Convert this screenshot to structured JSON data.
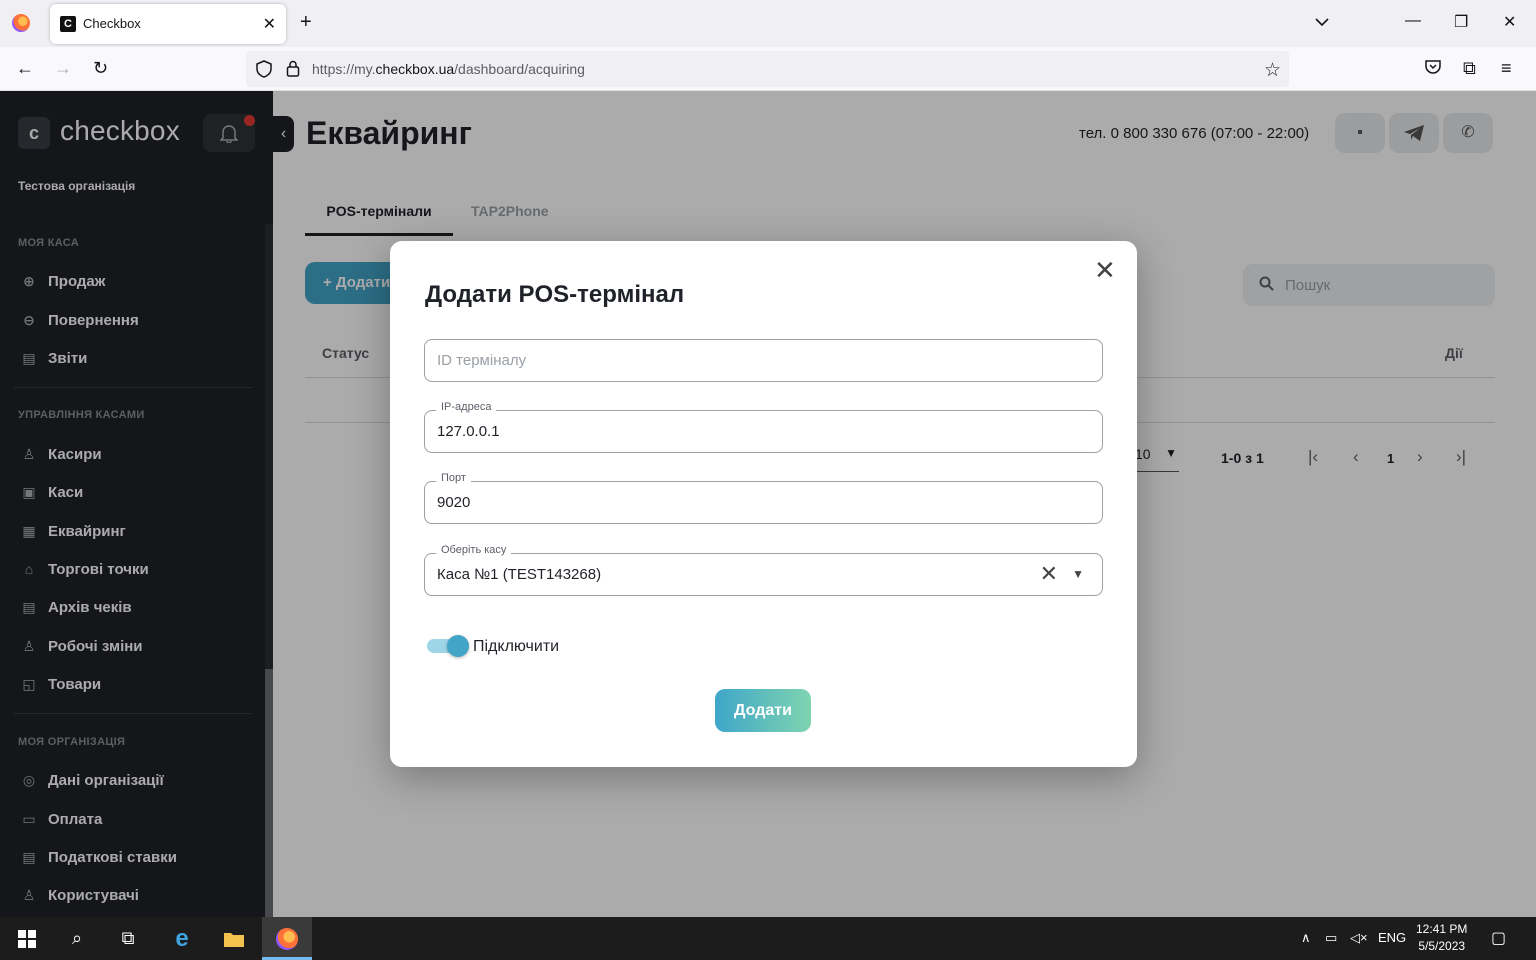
{
  "browser": {
    "tab_title": "Checkbox",
    "tab_favicon": "C",
    "url_prefix": "https://my.",
    "url_host": "checkbox.ua",
    "url_path": "/dashboard/acquiring"
  },
  "sidebar": {
    "brand": "checkbox",
    "brand_mark": "c",
    "org": "Тестова організація",
    "sections": [
      "МОЯ КАСА",
      "УПРАВЛІННЯ КАСАМИ",
      "МОЯ ОРГАНІЗАЦІЯ"
    ],
    "items": [
      {
        "label": "Продаж",
        "icon": "sale-icon"
      },
      {
        "label": "Повернення",
        "icon": "return-icon"
      },
      {
        "label": "Звіти",
        "icon": "report-icon"
      },
      {
        "label": "Касири",
        "icon": "cashier-icon"
      },
      {
        "label": "Каси",
        "icon": "register-icon"
      },
      {
        "label": "Еквайринг",
        "icon": "acquiring-icon"
      },
      {
        "label": "Торгові точки",
        "icon": "store-icon"
      },
      {
        "label": "Архів чеків",
        "icon": "archive-icon"
      },
      {
        "label": "Робочі зміни",
        "icon": "shifts-icon"
      },
      {
        "label": "Товари",
        "icon": "goods-icon"
      },
      {
        "label": "Дані організації",
        "icon": "org-data-icon"
      },
      {
        "label": "Оплата",
        "icon": "payment-icon"
      },
      {
        "label": "Податкові ставки",
        "icon": "tax-icon"
      },
      {
        "label": "Користувачі",
        "icon": "users-icon"
      }
    ],
    "active_item": "Еквайринг"
  },
  "main": {
    "title": "Еквайринг",
    "phone": "тел. 0 800 330 676 (07:00 - 22:00)",
    "tabs": [
      "POS-термінали",
      "TAP2Phone"
    ],
    "add_button": "+ Додати",
    "search_placeholder": "Пошук",
    "table_headers": {
      "status": "Статус",
      "actions": "Дії"
    },
    "per_page": "10",
    "range": "1-0 з 1",
    "page": "1"
  },
  "modal": {
    "title": "Додати POS-термінал",
    "fields": {
      "terminal_id": {
        "placeholder": "ID терміналу",
        "value": ""
      },
      "ip": {
        "label": "IP-адреса",
        "value": "127.0.0.1"
      },
      "port": {
        "label": "Порт",
        "value": "9020"
      },
      "register": {
        "label": "Оберіть касу",
        "value": "Каса №1 (TEST143268)"
      }
    },
    "toggle_label": "Підключити",
    "toggle_on": true,
    "submit": "Додати"
  },
  "taskbar": {
    "lang": "ENG",
    "time": "12:41 PM",
    "date": "5/5/2023"
  },
  "colors": {
    "accent": "#42a5c8",
    "sidebar": "#1f2228",
    "notification": "#e53935"
  }
}
